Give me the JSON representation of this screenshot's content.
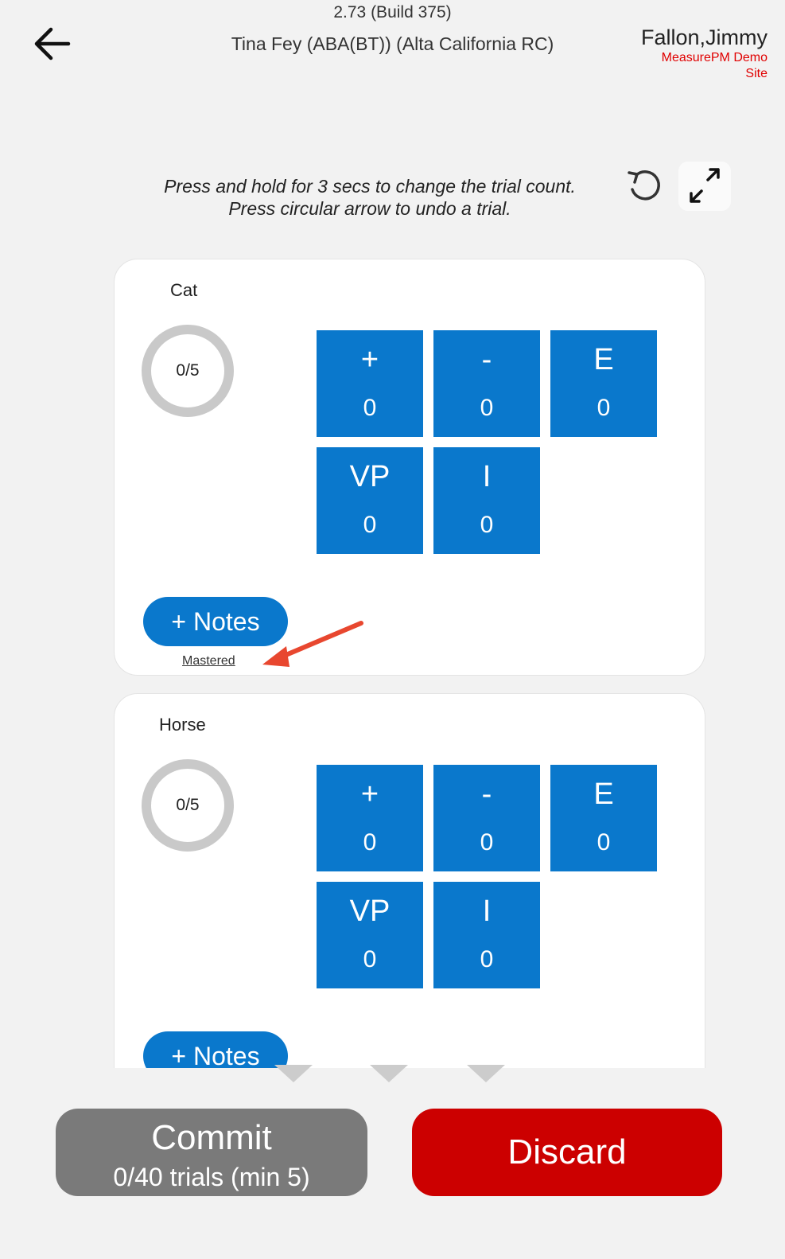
{
  "header": {
    "version": "2.73 (Build 375)",
    "client": "Tina Fey (ABA(BT)) (Alta California RC)",
    "user_name": "Fallon,Jimmy",
    "site": "MeasurePM Demo Site",
    "back_icon": "arrow-left-icon"
  },
  "instructions": {
    "line1": "Press and hold for 3 secs to change the trial count.",
    "line2": "Press circular arrow to undo a trial.",
    "undo_icon": "undo-circular-arrow-icon",
    "expand_icon": "expand-arrows-icon"
  },
  "targets": [
    {
      "name": "Cat",
      "progress": "0/5",
      "buttons": [
        {
          "symbol": "+",
          "count": "0"
        },
        {
          "symbol": "-",
          "count": "0"
        },
        {
          "symbol": "E",
          "count": "0"
        },
        {
          "symbol": "VP",
          "count": "0"
        },
        {
          "symbol": "I",
          "count": "0"
        }
      ],
      "notes_label": "+ Notes",
      "status_link": "Mastered"
    },
    {
      "name": "Horse",
      "progress": "0/5",
      "buttons": [
        {
          "symbol": "+",
          "count": "0"
        },
        {
          "symbol": "-",
          "count": "0"
        },
        {
          "symbol": "E",
          "count": "0"
        },
        {
          "symbol": "VP",
          "count": "0"
        },
        {
          "symbol": "I",
          "count": "0"
        }
      ],
      "notes_label": "+ Notes"
    }
  ],
  "footer": {
    "commit_label": "Commit",
    "commit_sub": "0/40 trials (min 5)",
    "discard_label": "Discard"
  },
  "colors": {
    "accent_blue": "#0a78cc",
    "discard_red": "#cc0000",
    "commit_gray": "#7a7a7a",
    "site_red": "#e00000",
    "annotation_arrow": "#e8472f"
  }
}
